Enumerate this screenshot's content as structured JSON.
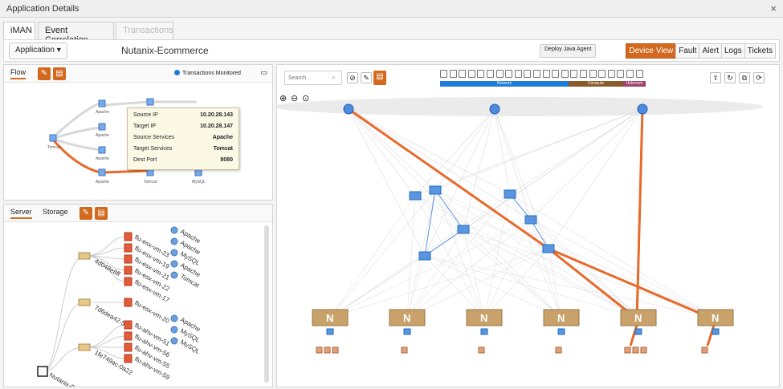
{
  "window": {
    "title": "Application Details",
    "close_glyph": "×"
  },
  "tabs": [
    {
      "label": "iMAN",
      "active": true
    },
    {
      "label": "Event Correlation",
      "active": false
    },
    {
      "label": "Transactions",
      "disabled": true
    }
  ],
  "toolbar": {
    "application_btn": "Application ▾",
    "app_title": "Nutanix-Ecommerce",
    "deploy_btn": "Deploy Java Agent",
    "right_tabs": [
      "Device View",
      "Fault",
      "Alert",
      "Logs",
      "Tickets"
    ]
  },
  "flow": {
    "tab": "Flow",
    "legend": "Transactions Monitored",
    "tooltip": {
      "rows": [
        {
          "k": "Source IP",
          "v": "10.20.28.143"
        },
        {
          "k": "Target IP",
          "v": "10.20.28.147"
        },
        {
          "k": "Source Services",
          "v": "Apache"
        },
        {
          "k": "Target Services",
          "v": "Tomcat"
        },
        {
          "k": "Dest Port",
          "v": "8080"
        }
      ]
    },
    "node_labels": [
      "Tomcat",
      "Apache",
      "Apache",
      "Apache",
      "Apache",
      "Tomcat",
      "MySQL"
    ]
  },
  "server": {
    "tabs": [
      "Server",
      "Storage"
    ],
    "tree": {
      "root": "Nutanix-B",
      "hosts": [
        "4d048e8ff",
        "7d6dea42-5d5",
        "1fe749ac-0a22"
      ],
      "vms": [
        {
          "name": "flu-esx-vm-23",
          "service": "Apache"
        },
        {
          "name": "flu-esx-vm-19",
          "service": "Apache"
        },
        {
          "name": "flu-esx-vm-21",
          "service": "MySQL"
        },
        {
          "name": "flu-esx-vm-22",
          "service": "Apache"
        },
        {
          "name": "flu-esx-vm-17",
          "service": "Tomcat"
        },
        {
          "name": "flu-esx-vm-20",
          "service": ""
        },
        {
          "name": "flu-ahv-vm-51",
          "service": "Apache"
        },
        {
          "name": "flu-ahv-vm-56",
          "service": "MySQL"
        },
        {
          "name": "flu-ahv-vm-55",
          "service": "MySQL"
        },
        {
          "name": "flu-ahv-vm-59",
          "service": ""
        }
      ]
    }
  },
  "device_view": {
    "search_placeholder": "Search...",
    "bar_labels": [
      "Network",
      "Compute",
      "Unknown"
    ],
    "colors": {
      "network": "#1e7bd8",
      "compute": "#8b5a2b",
      "unknown": "#a0426e",
      "accent": "#e8692a",
      "switch": "#1f6fc2",
      "host": "#c8a26a"
    },
    "host_glyph": "N"
  }
}
